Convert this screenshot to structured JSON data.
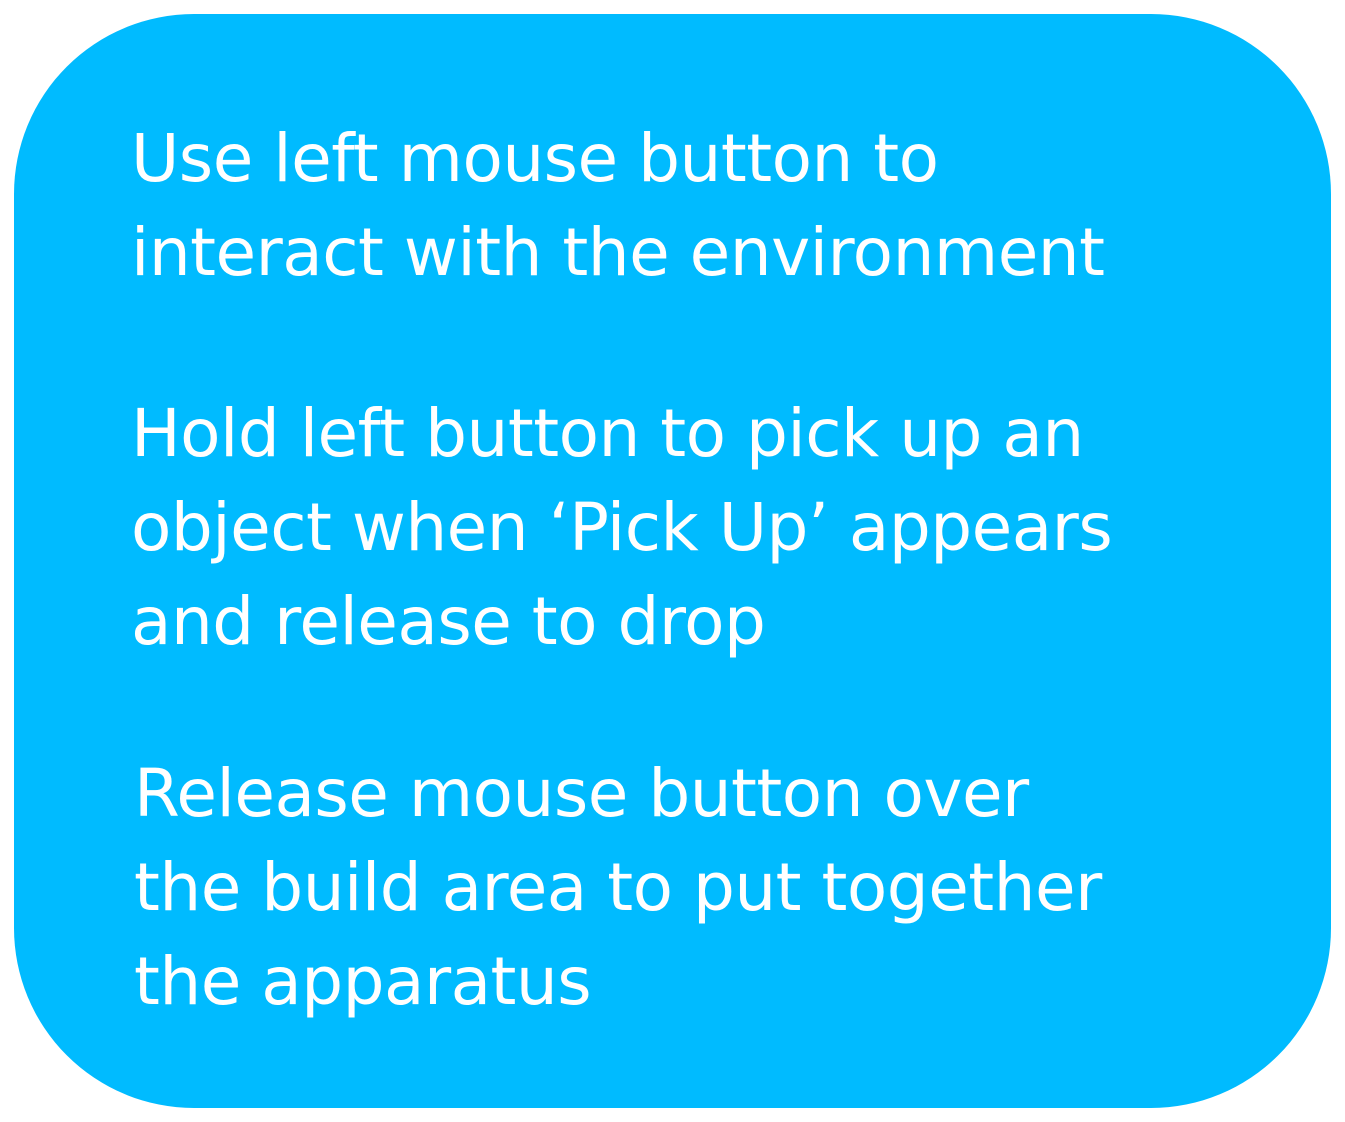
{
  "panel": {
    "background_color": "#00BBFF",
    "text_color": "#FFFFFF",
    "instructions": [
      "Use left mouse button to\ninteract with the environment",
      "Hold left button to pick up an\nobject when ‘Pick Up’ appears\nand release to drop",
      "Release mouse button over\nthe build area to put together\nthe apparatus"
    ]
  }
}
